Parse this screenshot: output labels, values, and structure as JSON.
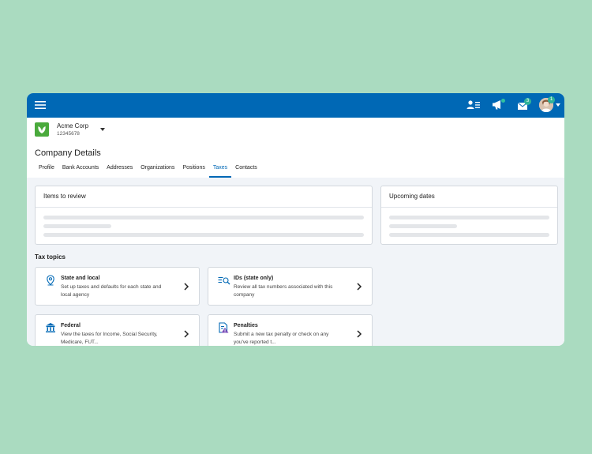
{
  "company": {
    "name": "Acme Corp",
    "id": "12345678"
  },
  "header": {
    "notifications": {
      "messages_count": "3",
      "avatar_count": "1"
    }
  },
  "page": {
    "title": "Company Details"
  },
  "tabs": [
    {
      "label": "Profile"
    },
    {
      "label": "Bank Accounts"
    },
    {
      "label": "Addresses"
    },
    {
      "label": "Organizations"
    },
    {
      "label": "Positions"
    },
    {
      "label": "Taxes",
      "active": true
    },
    {
      "label": "Contacts"
    }
  ],
  "cards": {
    "items_to_review": "Items to review",
    "upcoming_dates": "Upcoming dates"
  },
  "tax_topics": {
    "title": "Tax topics",
    "items": [
      {
        "title": "State and local",
        "desc": "Set up taxes and defaults for each state and local agency",
        "icon": "map-pin-icon"
      },
      {
        "title": "IDs (state only)",
        "desc": "Review all tax numbers associated with this company",
        "icon": "id-search-icon"
      },
      {
        "title": "Federal",
        "desc": "View the taxes for Income, Social Security, Medicare, FUT...",
        "icon": "bank-building-icon"
      },
      {
        "title": "Penalties",
        "desc": "Submit a new tax penalty or check on any you've reported t...",
        "icon": "penalty-document-icon"
      }
    ]
  },
  "colors": {
    "brand_blue": "#0068b5",
    "background": "#aadbc0",
    "badge": "#2fb39a",
    "logo_green": "#4aaa3c"
  }
}
